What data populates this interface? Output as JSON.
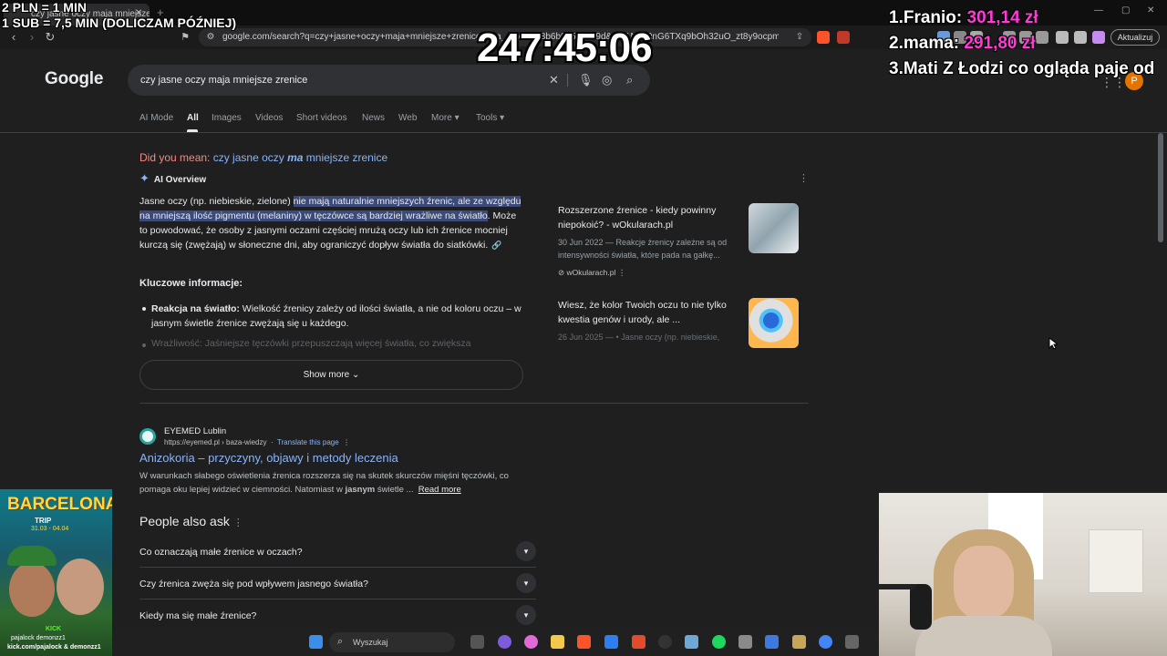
{
  "browser": {
    "tab_title": "czy jasne oczy maja mniejsze źrenic",
    "url": "google.com/search?q=czy+jasne+oczy+maja+mniejsze+zrenice&sca_esv=0c48b6b0a50c3b9d&ei=ANbq9nG6TXq9bOh32uO_zt8y9ocpmJmwMQ%...",
    "update_button": "Aktualizuj"
  },
  "google": {
    "logo": "Google",
    "query": "czy jasne oczy maja mniejsze zrenice",
    "avatar_letter": "P",
    "tabs": [
      {
        "label": "AI Mode"
      },
      {
        "label": "All"
      },
      {
        "label": "Images"
      },
      {
        "label": "Videos"
      },
      {
        "label": "Short videos"
      },
      {
        "label": "News"
      },
      {
        "label": "Web"
      },
      {
        "label": "More"
      },
      {
        "label": "Tools"
      }
    ]
  },
  "did_you_mean": {
    "label": "Did you mean:",
    "pre": "czy jasne oczy ",
    "bold": "ma",
    "post": " mniejsze zrenice"
  },
  "ai_overview": {
    "heading": "AI Overview",
    "lead": "Jasne oczy (np. niebieskie, zielone) ",
    "highlight": "nie mają naturalnie mniejszych źrenic, ale ze względu na mniejszą ilość pigmentu (melaniny) w tęczówce są bardziej wrażliwe na światło",
    "rest": ". Może to powodować, że osoby z jasnymi oczami częściej mrużą oczy lub ich źrenice mocniej kurczą się (zwężają) w słoneczne dni, aby ograniczyć dopływ światła do siatkówki.",
    "key_heading": "Kluczowe informacje:",
    "bullet1_bold": "Reakcja na światło:",
    "bullet1_text": " Wielkość źrenicy zależy od ilości światła, a nie od koloru oczu – w jasnym świetle źrenice zwężają się u każdego.",
    "bullet2_faded": "Wrażliwość: Jaśniejsze tęczówki przepuszczają więcej światła, co zwiększa",
    "show_more": "Show more"
  },
  "source_cards": [
    {
      "title": "Rozszerzone źrenice - kiedy powinny niepokoić? - wOkularach.pl",
      "snippet": "30 Jun 2022 — Reakcje źrenicy zależne są od intensywności światła, które pada na gałkę...",
      "site": "wOkularach.pl"
    },
    {
      "title": "Wiesz, że kolor Twoich oczu to nie tylko kwestia genów i urody, ale ...",
      "snippet": "26 Jun 2025 — • Jasne oczy (np. niebieskie,",
      "site": ""
    }
  ],
  "result": {
    "site_name": "EYEMED Lublin",
    "url": "https://eyemed.pl › baza-wiedzy",
    "translate": "Translate this page",
    "title": "Anizokoria – przyczyny, objawy i metody leczenia",
    "snippet_pre": "W warunkach słabego oświetlenia źrenica rozszerza się na skutek skurczów mięśni tęczówki, co pomaga oku lepiej widzieć w ciemności. Natomiast w ",
    "snippet_bold": "jasnym",
    "snippet_post": " świetle ...",
    "read_more": "Read more"
  },
  "people_also_ask": {
    "title": "People also ask",
    "questions": [
      "Co oznaczają małe źrenice w oczach?",
      "Czy źrenica zwęża się pod wpływem jasnego światła?",
      "Kiedy ma się małe źrenice?"
    ]
  },
  "overlay": {
    "line1": "2 PLN = 1 MIN",
    "line2": "1 SUB = 7,5 MIN (DOLICZAM PÓŹNIEJ)",
    "timer": "247:45:06",
    "leaderboard": [
      {
        "rank": "1.",
        "name": "Franio:",
        "amount": "301,14 zł"
      },
      {
        "rank": "2.",
        "name": "mama:",
        "amount": "291,80 zł"
      },
      {
        "rank": "3.",
        "name": "Mati Z Łodzi co ogląda paje od",
        "amount": ""
      }
    ]
  },
  "promo": {
    "title": "BARCELONA",
    "subtitle": "TRIP",
    "dates": "31.03 - 04.04",
    "kick": "KICK",
    "names": "pajalock   demonzz1",
    "url": "kick.com/pajalock & demonzz1"
  },
  "taskbar": {
    "search_label": "Wyszukaj"
  }
}
